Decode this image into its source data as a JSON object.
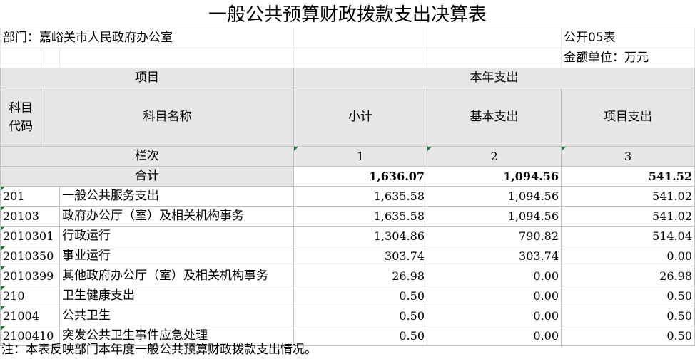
{
  "title": "一般公共预算财政拨款支出决算表",
  "dept": "部门：嘉峪关市人民政府办公室",
  "form_no": "公开05表",
  "unit": "金额单位：万元",
  "header": {
    "project": "项目",
    "this_year": "本年支出",
    "code": "科目代码",
    "name": "科目名称",
    "subtotal": "小计",
    "basic": "基本支出",
    "proj_exp": "项目支出",
    "lanci": "栏次",
    "col1": "1",
    "col2": "2",
    "col3": "3",
    "total_label": "合计",
    "total_sub": "1,636.07",
    "total_basic": "1,094.56",
    "total_proj": "541.52"
  },
  "rows": [
    {
      "code": "201",
      "name": "一般公共服务支出",
      "sub": "1,635.58",
      "basic": "1,094.56",
      "proj": "541.02"
    },
    {
      "code": "20103",
      "name": "政府办公厅（室）及相关机构事务",
      "sub": "1,635.58",
      "basic": "1,094.56",
      "proj": "541.02"
    },
    {
      "code": "2010301",
      "name": "行政运行",
      "sub": "1,304.86",
      "basic": "790.82",
      "proj": "514.04"
    },
    {
      "code": "2010350",
      "name": "事业运行",
      "sub": "303.74",
      "basic": "303.74",
      "proj": "0.00"
    },
    {
      "code": "2010399",
      "name": "其他政府办公厅（室）及相关机构事务",
      "sub": "26.98",
      "basic": "0.00",
      "proj": "26.98"
    },
    {
      "code": "210",
      "name": "卫生健康支出",
      "sub": "0.50",
      "basic": "0.00",
      "proj": "0.50"
    },
    {
      "code": "21004",
      "name": "公共卫生",
      "sub": "0.50",
      "basic": "0.00",
      "proj": "0.50"
    },
    {
      "code": "2100410",
      "name": "突发公共卫生事件应急处理",
      "sub": "0.50",
      "basic": "0.00",
      "proj": "0.50"
    }
  ],
  "note": "注：本表反映部门本年度一般公共预算财政拨款支出情况。"
}
